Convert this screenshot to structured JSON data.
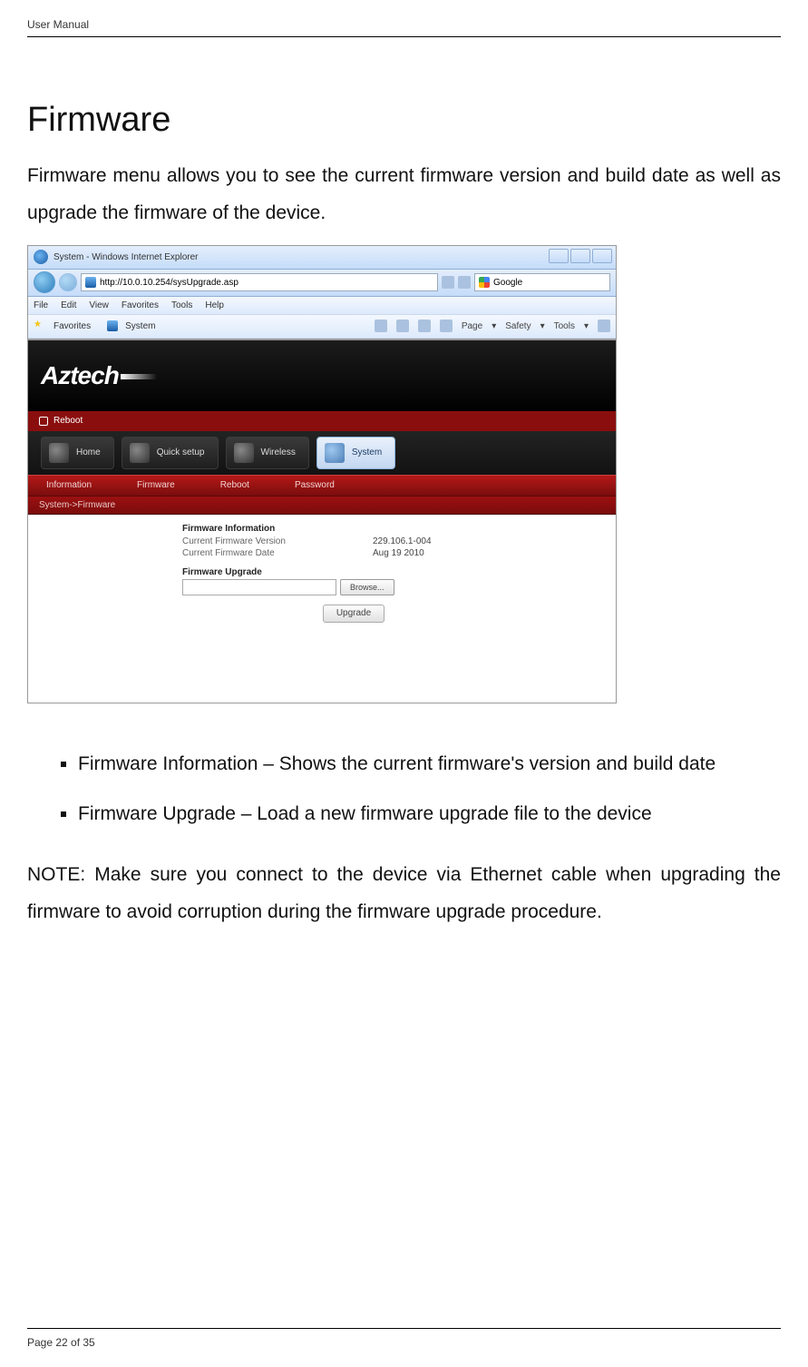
{
  "header": {
    "label": "User Manual"
  },
  "title": "Firmware",
  "intro": "Firmware menu allows you to see the current firmware version and build date as well as upgrade the firmware of the device.",
  "browser": {
    "window_title": "System - Windows Internet Explorer",
    "url": "http://10.0.10.254/sysUpgrade.asp",
    "search_placeholder": "Google",
    "menus": {
      "file": "File",
      "edit": "Edit",
      "view": "View",
      "favorites": "Favorites",
      "tools": "Tools",
      "help": "Help"
    },
    "fav_label": "Favorites",
    "fav_tab": "System",
    "toolbar": {
      "page": "Page",
      "safety": "Safety",
      "tools": "Tools"
    }
  },
  "app": {
    "logo": "Aztech",
    "reboot": "Reboot",
    "nav": {
      "home": "Home",
      "quick": "Quick setup",
      "wireless": "Wireless",
      "system": "System"
    },
    "subnav": {
      "information": "Information",
      "firmware": "Firmware",
      "reboot": "Reboot",
      "password": "Password"
    },
    "breadcrumb": "System->Firmware",
    "fw_info_title": "Firmware Information",
    "ver_label": "Current Firmware Version",
    "ver_value": "229.106.1-004",
    "date_label": "Current Firmware Date",
    "date_value": "Aug 19 2010",
    "upg_title": "Firmware Upgrade",
    "browse": "Browse...",
    "upgrade": "Upgrade"
  },
  "bullets": {
    "b1": "Firmware Information – Shows the current firmware's version and build date",
    "b2": "Firmware Upgrade – Load a new firmware upgrade file to the device"
  },
  "note": "NOTE: Make sure you connect to the device via Ethernet cable when upgrading the firmware to avoid corruption during the firmware upgrade procedure.",
  "footer": {
    "page": "Page 22 of 35"
  }
}
